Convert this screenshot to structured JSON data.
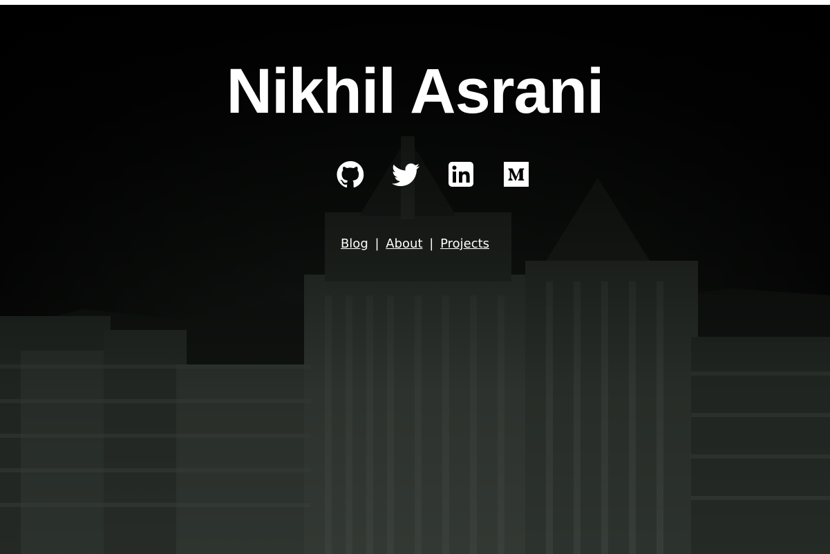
{
  "header": {
    "name": "Nikhil Asrani"
  },
  "social": [
    {
      "name": "github",
      "icon": "github-icon"
    },
    {
      "name": "twitter",
      "icon": "twitter-icon"
    },
    {
      "name": "linkedin",
      "icon": "linkedin-icon"
    },
    {
      "name": "medium",
      "icon": "medium-icon"
    }
  ],
  "nav": {
    "blog": "Blog",
    "about": "About",
    "projects": "Projects",
    "separator": "|"
  },
  "colors": {
    "text": "#ffffff",
    "background": "#000000"
  }
}
